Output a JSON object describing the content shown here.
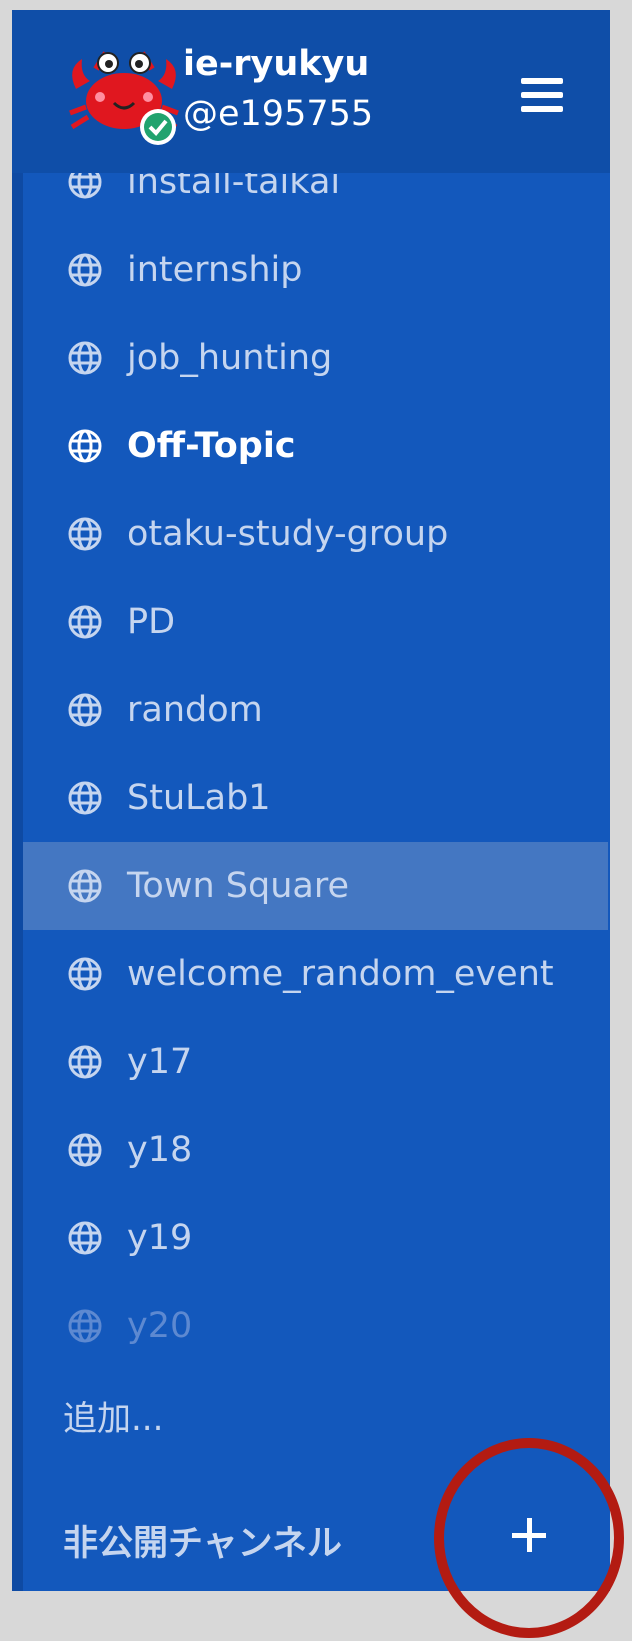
{
  "header": {
    "team_name": "ie-ryukyu",
    "username": "@e195755"
  },
  "public_channels": [
    {
      "label": "install-taikai",
      "state": "normal"
    },
    {
      "label": "internship",
      "state": "normal"
    },
    {
      "label": "job_hunting",
      "state": "normal"
    },
    {
      "label": "Off-Topic",
      "state": "unread"
    },
    {
      "label": "otaku-study-group",
      "state": "normal"
    },
    {
      "label": "PD",
      "state": "normal"
    },
    {
      "label": "random",
      "state": "normal"
    },
    {
      "label": "StuLab1",
      "state": "normal"
    },
    {
      "label": "Town Square",
      "state": "active"
    },
    {
      "label": "welcome_random_event",
      "state": "normal"
    },
    {
      "label": "y17",
      "state": "normal"
    },
    {
      "label": "y18",
      "state": "normal"
    },
    {
      "label": "y19",
      "state": "normal"
    },
    {
      "label": "y20",
      "state": "faded"
    }
  ],
  "add_more_label": "追加...",
  "private_section": {
    "title": "非公開チャンネル"
  },
  "colors": {
    "sidebar_bg": "#1358bc",
    "header_bg": "#0f4ea8",
    "active_bg": "#4477c2",
    "highlight_circle": "#b31b12"
  },
  "icons": {
    "channel_icon": "globe-icon",
    "menu_icon": "hamburger-menu-icon",
    "add_icon": "plus-icon"
  }
}
